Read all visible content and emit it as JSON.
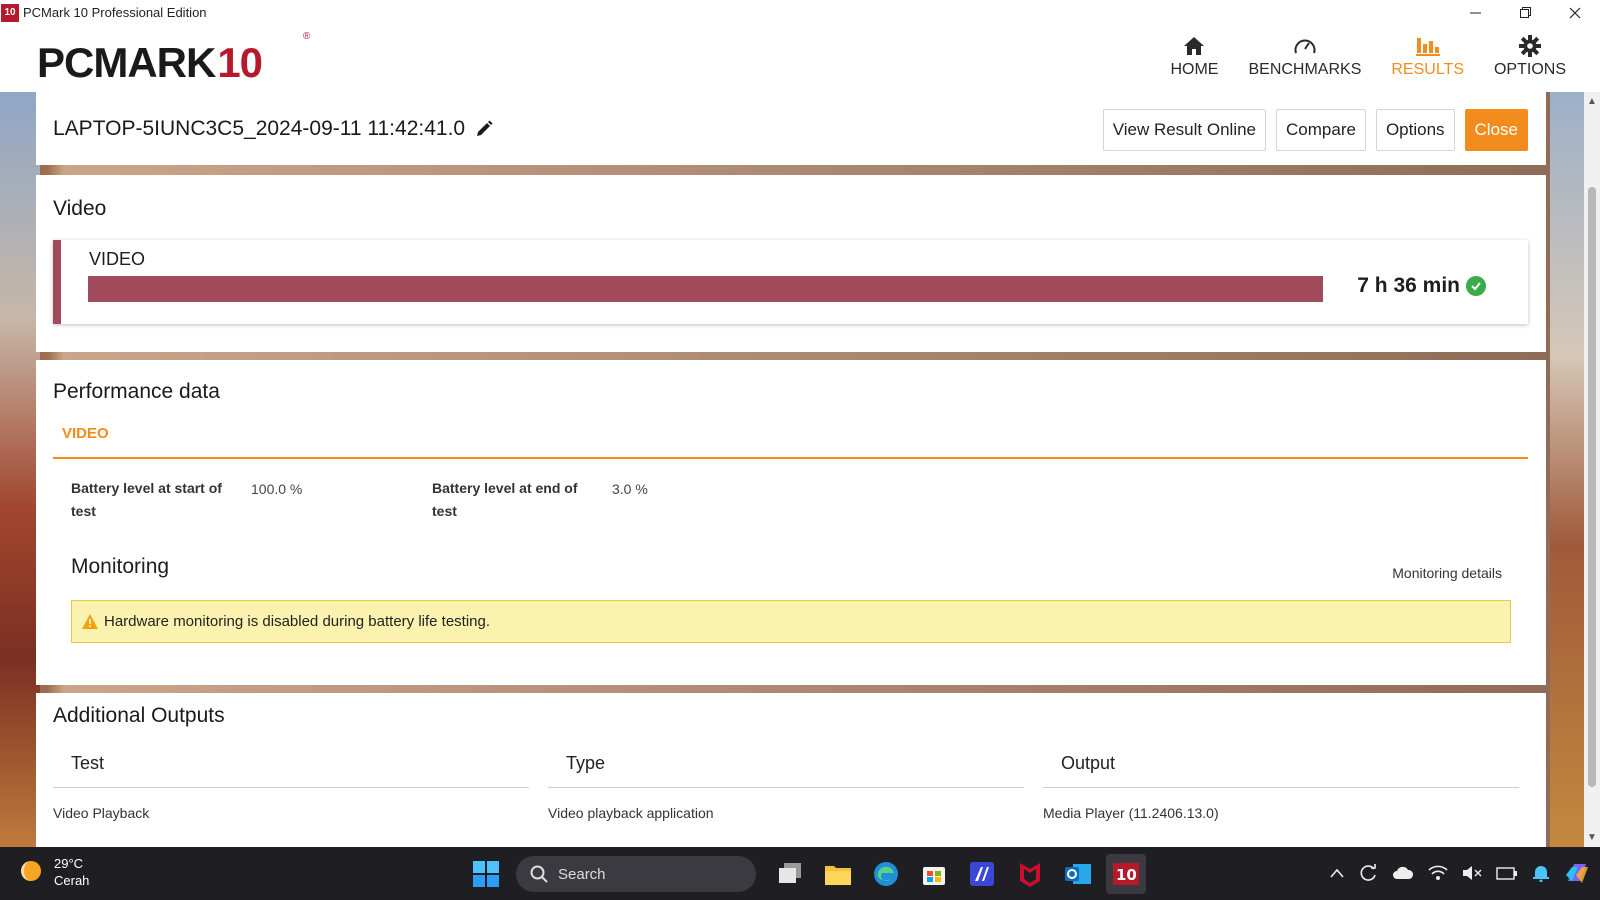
{
  "window": {
    "title": "PCMark 10 Professional Edition",
    "app_icon": "10"
  },
  "header": {
    "logo_main": "PCMARK",
    "logo_ten": "10",
    "logo_reg": "®",
    "nav": [
      {
        "label": "HOME",
        "icon": "home-icon",
        "active": false
      },
      {
        "label": "BENCHMARKS",
        "icon": "gauge-icon",
        "active": false
      },
      {
        "label": "RESULTS",
        "icon": "bar-chart-icon",
        "active": true
      },
      {
        "label": "OPTIONS",
        "icon": "gear-icon",
        "active": false
      }
    ]
  },
  "result": {
    "name": "LAPTOP-5IUNC3C5_2024-09-11 11:42:41.0",
    "buttons": {
      "view_online": "View Result Online",
      "compare": "Compare",
      "options": "Options",
      "close": "Close"
    }
  },
  "video": {
    "section_title": "Video",
    "card_label": "VIDEO",
    "score": "7 h 36 min",
    "bar_fraction": 1.0,
    "bar_color": "#a04a5c"
  },
  "performance": {
    "section_title": "Performance data",
    "tab": "VIDEO",
    "battery_start_label": "Battery level at start of test",
    "battery_start_value": "100.0 %",
    "battery_end_label": "Battery level at end of test",
    "battery_end_value": "3.0 %",
    "monitoring_title": "Monitoring",
    "monitoring_link": "Monitoring details",
    "warning": "Hardware monitoring is disabled during battery life testing."
  },
  "outputs": {
    "section_title": "Additional Outputs",
    "columns": [
      "Test",
      "Type",
      "Output"
    ],
    "rows": [
      [
        "Video Playback",
        "Video playback application",
        "Media Player (11.2406.13.0)"
      ]
    ]
  },
  "taskbar": {
    "temperature": "29°C",
    "condition": "Cerah",
    "search_placeholder": "Search"
  },
  "colors": {
    "accent": "#f28c1c",
    "brand_red": "#b5192b",
    "video_bar": "#a04a5c",
    "success": "#3bab4b",
    "warning_bg": "#fcf2b0"
  }
}
